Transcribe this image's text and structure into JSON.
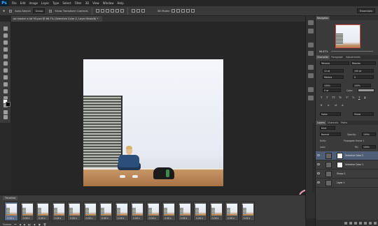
{
  "app": {
    "logo": "Ps"
  },
  "menu": [
    "File",
    "Edit",
    "Image",
    "Layer",
    "Type",
    "Select",
    "Filter",
    "3D",
    "View",
    "Window",
    "Help"
  ],
  "options": {
    "auto_select": "Auto-Select:",
    "group": "Group",
    "show_transform": "Show Transform Controls",
    "mode3d": "3D Mode:",
    "workspace": "Essentials"
  },
  "doc_tab": "ao master a lot 93.psd @ 66.7% (Selective Color 2, Layer Mask/8) *",
  "navigator": {
    "title": "Navigator",
    "zoom": "66.67%"
  },
  "character": {
    "tabs": [
      "Character",
      "Paragraph",
      "Adjustments"
    ],
    "font": "Tahoma",
    "style": "Regular",
    "size": "12 pt",
    "leading": "100 pt",
    "kerning": "Metrics",
    "tracking": "0",
    "vscale": "100%",
    "hscale": "100%",
    "baseline": "0 pt",
    "color_label": "Color:",
    "language": "Swiss",
    "aa": "Sharp"
  },
  "layers": {
    "tabs": [
      "Layers",
      "Channels",
      "Paths"
    ],
    "kind": "Kind",
    "blend": "Normal",
    "opacity_label": "Opacity:",
    "opacity": "100%",
    "unify_label": "Unify:",
    "propagate": "Propagate Frame 1",
    "lock_label": "Lock:",
    "fill_label": "Fill:",
    "fill": "100%",
    "items": [
      {
        "name": "Selective Color 2",
        "selected": true
      },
      {
        "name": "Selective Color 1",
        "selected": false
      },
      {
        "name": "Group 1",
        "selected": false
      },
      {
        "name": "Layer 1",
        "selected": false
      }
    ]
  },
  "timeline": {
    "title": "Timeline",
    "frames": [
      {
        "num": "1",
        "delay": "0.06 ▾"
      },
      {
        "num": "2",
        "delay": "0.06 ▾"
      },
      {
        "num": "3",
        "delay": "0.06 ▾"
      },
      {
        "num": "4",
        "delay": "0.06 ▾"
      },
      {
        "num": "5",
        "delay": "0.06 ▾"
      },
      {
        "num": "6",
        "delay": "0.06 ▾"
      },
      {
        "num": "7",
        "delay": "0.06 ▾"
      },
      {
        "num": "8",
        "delay": "0.06 ▾"
      },
      {
        "num": "9",
        "delay": "0.06 ▾"
      },
      {
        "num": "10",
        "delay": "0.06 ▾"
      },
      {
        "num": "11",
        "delay": "0.06 ▾"
      },
      {
        "num": "12",
        "delay": "0.06 ▾"
      },
      {
        "num": "13",
        "delay": "0.06 ▾"
      },
      {
        "num": "14",
        "delay": "0.06 ▾"
      },
      {
        "num": "15",
        "delay": "0.06 ▾"
      },
      {
        "num": "16",
        "delay": "0.06 ▾"
      }
    ],
    "loop": "Forever"
  },
  "colors": {
    "accent_select": "#4f5e77",
    "highlight_circle": "#f2a3b8",
    "ps_blue": "#31a8ff"
  }
}
